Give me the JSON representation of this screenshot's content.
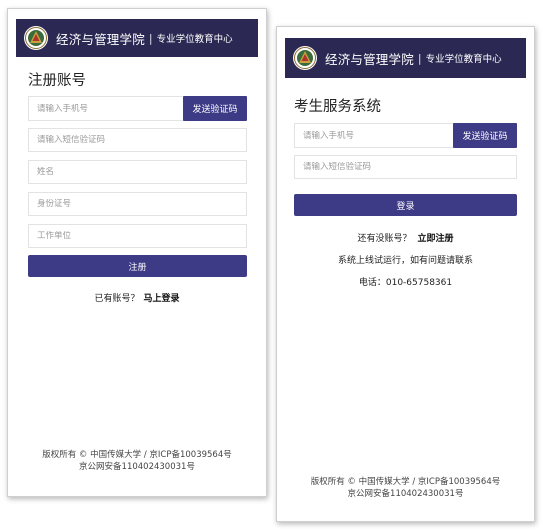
{
  "header": {
    "school_name": "经济与管理学院",
    "separator": "|",
    "center_name": "专业学位教育中心",
    "colors": {
      "header_bg": "#2b2953",
      "accent": "#3d3a86"
    }
  },
  "register": {
    "title": "注册账号",
    "phone_placeholder": "请输入手机号",
    "send_code_label": "发送验证码",
    "sms_placeholder": "请输入短信验证码",
    "name_placeholder": "姓名",
    "id_placeholder": "身份证号",
    "employer_placeholder": "工作单位",
    "submit_label": "注册",
    "have_account_text": "已有账号？",
    "login_link": "马上登录",
    "footer_line1": "版权所有 © 中国传媒大学 / 京ICP备10039564号",
    "footer_line2": "京公网安备110402430031号"
  },
  "login": {
    "title": "考生服务系统",
    "phone_placeholder": "请输入手机号",
    "send_code_label": "发送验证码",
    "sms_placeholder": "请输入短信验证码",
    "submit_label": "登录",
    "no_account_text": "还有没账号？",
    "register_link": "立即注册",
    "notice": "系统上线试运行，如有问题请联系",
    "phone_text": "电话：010-65758361",
    "footer_line1": "版权所有 © 中国传媒大学 / 京ICP备10039564号",
    "footer_line2": "京公网安备110402430031号"
  }
}
